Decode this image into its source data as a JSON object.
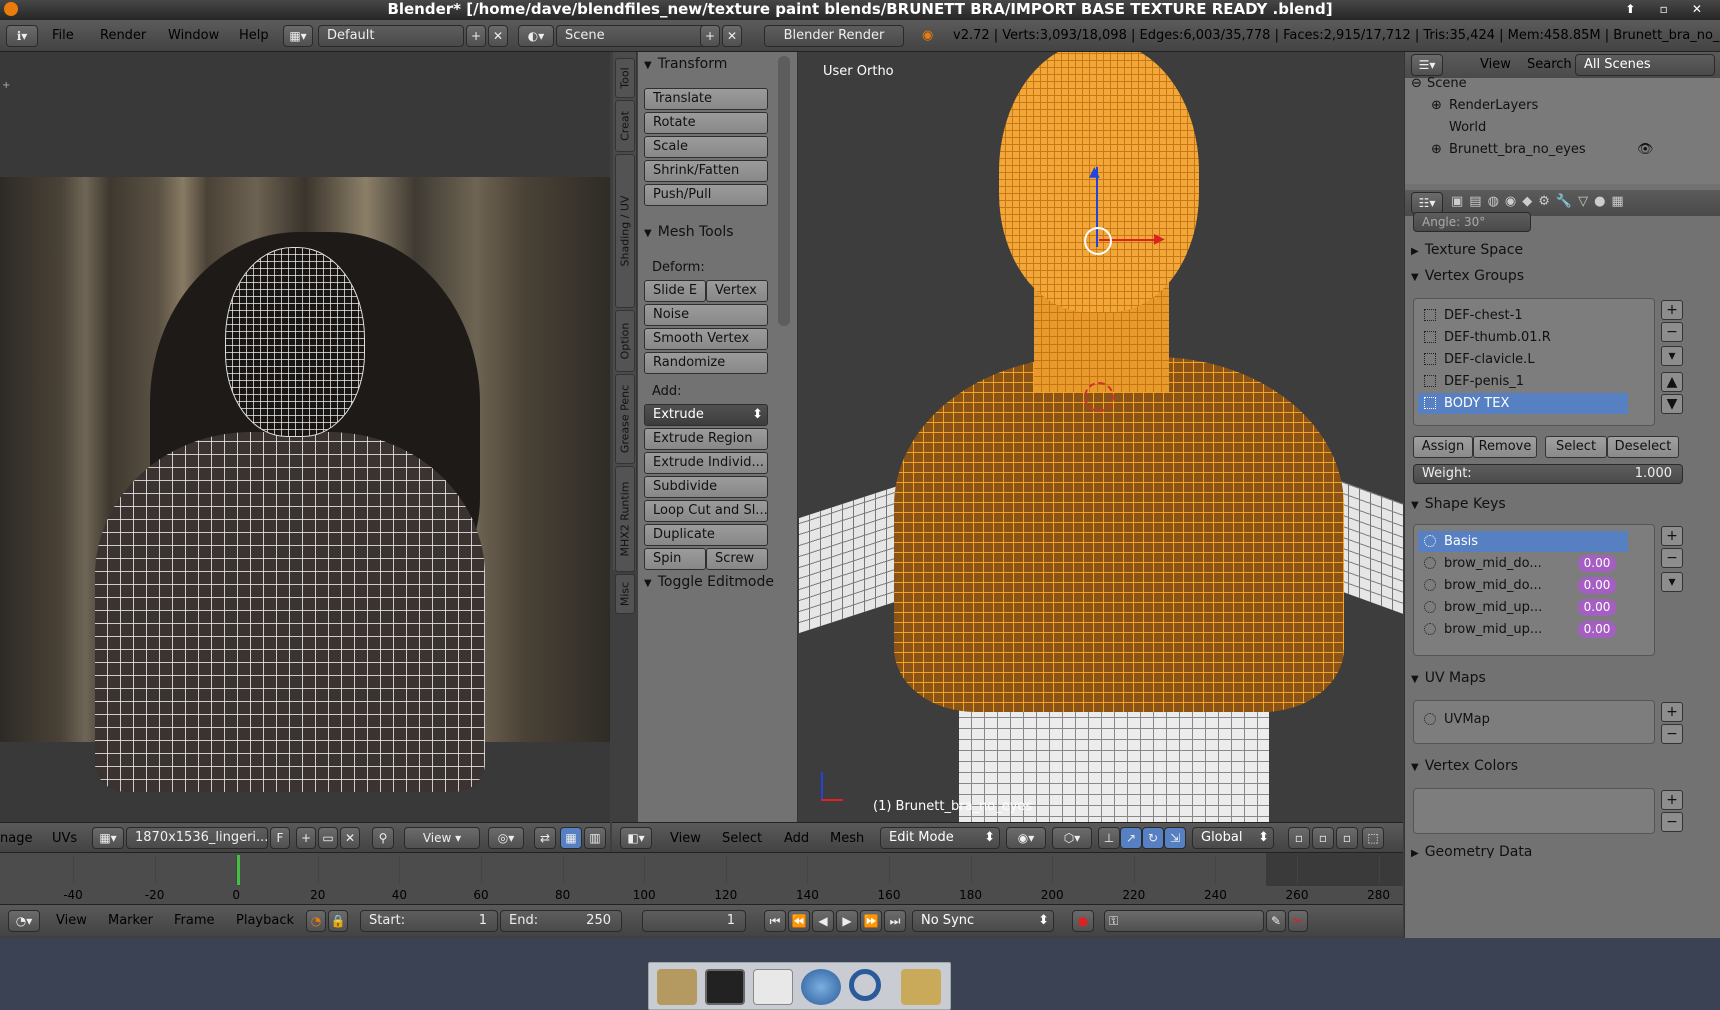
{
  "titlebar": {
    "title": "Blender* [/home/dave/blendfiles_new/texture paint blends/BRUNETT BRA/IMPORT BASE TEXTURE READY .blend]",
    "controls": "⬆ ▫ ✕"
  },
  "infobar": {
    "menus": [
      "File",
      "Render",
      "Window",
      "Help"
    ],
    "screen_layout": "Default",
    "scene": "Scene",
    "engine": "Blender Render",
    "stats": "v2.72 | Verts:3,093/18,098 | Edges:6,003/35,778 | Faces:2,915/17,712 | Tris:35,424 | Mem:458.85M | Brunett_bra_no_eyes"
  },
  "uv_editor": {
    "header_left": "nage",
    "menus": [
      "UVs"
    ],
    "image_name": "1870x1536_lingeri...",
    "fake_user": "F",
    "view_menu": "View"
  },
  "tool_tabs": [
    "Tool",
    "Creat",
    "Shading / UV",
    "Option",
    "Grease Penc",
    "MHX2 Runtim",
    "Misc"
  ],
  "tool_shelf": {
    "transform_header": "Transform",
    "transform_buttons": [
      "Translate",
      "Rotate",
      "Scale",
      "Shrink/Fatten",
      "Push/Pull"
    ],
    "mesh_tools_header": "Mesh Tools",
    "deform_label": "Deform:",
    "slide_edge": "Slide E",
    "vertex": "Vertex",
    "deform_buttons": [
      "Noise",
      "Smooth Vertex",
      "Randomize"
    ],
    "add_label": "Add:",
    "extrude": "Extrude",
    "add_buttons": [
      "Extrude Region",
      "Extrude Individ...",
      "Subdivide",
      "Loop Cut and Sl...",
      "Duplicate"
    ],
    "spin": "Spin",
    "screw": "Screw",
    "toggle_header": "Toggle Editmode"
  },
  "viewport": {
    "view_label": "User Ortho",
    "object_label": "(1) Brunett_bra_no_eyes",
    "menus": [
      "View",
      "Select",
      "Add",
      "Mesh"
    ],
    "mode": "Edit Mode",
    "orientation": "Global"
  },
  "outliner": {
    "menus": [
      "View",
      "Search"
    ],
    "filter": "All Scenes",
    "items": [
      "Scene",
      "RenderLayers",
      "World",
      "Brunett_bra_no_eyes"
    ]
  },
  "properties": {
    "angle_label": "Angle:",
    "angle_value": "30°",
    "texture_space": "Texture Space",
    "vertex_groups_header": "Vertex Groups",
    "vertex_groups": [
      "DEF-chest-1",
      "DEF-thumb.01.R",
      "DEF-clavicle.L",
      "DEF-penis_1",
      "BODY TEX"
    ],
    "vg_buttons": [
      "Assign",
      "Remove",
      "Select",
      "Deselect"
    ],
    "weight_label": "Weight:",
    "weight_value": "1.000",
    "shape_keys_header": "Shape Keys",
    "shape_keys": [
      {
        "name": "Basis",
        "value": ""
      },
      {
        "name": "brow_mid_do...",
        "value": "0.00"
      },
      {
        "name": "brow_mid_do...",
        "value": "0.00"
      },
      {
        "name": "brow_mid_up...",
        "value": "0.00"
      },
      {
        "name": "brow_mid_up...",
        "value": "0.00"
      }
    ],
    "uv_maps_header": "UV Maps",
    "uv_map": "UVMap",
    "vertex_colors_header": "Vertex Colors",
    "geometry_data_header": "Geometry Data"
  },
  "timeline": {
    "ticks": [
      "-40",
      "-20",
      "0",
      "20",
      "40",
      "60",
      "80",
      "100",
      "120",
      "140",
      "160",
      "180",
      "200",
      "220",
      "240",
      "260",
      "280"
    ],
    "menus": [
      "View",
      "Marker",
      "Frame",
      "Playback"
    ],
    "start_label": "Start:",
    "start_value": "1",
    "end_label": "End:",
    "end_value": "250",
    "current_frame": "1",
    "sync": "No Sync"
  },
  "taskbar": {
    "items": [
      "file-manager",
      "terminal",
      "text-editor",
      "browser",
      "search",
      "folder"
    ]
  },
  "colors": {
    "selection": "#ff9a1a",
    "accent": "#5680c2",
    "shapekey_value": "#a55ec2",
    "window_bg": "#3f3f3f"
  }
}
